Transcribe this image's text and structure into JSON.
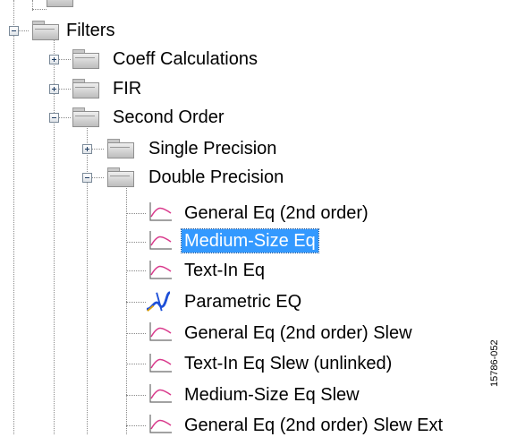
{
  "tree": {
    "filters": "Filters",
    "coeff_calculations": "Coeff Calculations",
    "fir": "FIR",
    "second_order": "Second Order",
    "single_precision": "Single Precision",
    "double_precision": "Double Precision",
    "items": [
      "General Eq (2nd order)",
      "Medium-Size Eq",
      "Text-In Eq",
      "Parametric EQ",
      "General Eq (2nd order) Slew",
      "Text-In Eq Slew (unlinked)",
      "Medium-Size Eq Slew",
      "General Eq (2nd order) Slew Ext"
    ],
    "selected_item": "Medium-Size Eq"
  },
  "figure_id": "15786-052",
  "colors": {
    "selection": "#3399ff",
    "connector": "#8a8a8a",
    "parametric_icon": "#1d4fd8"
  },
  "icons": {
    "folder": "folder-icon",
    "leaf": "graph-curve-icon",
    "parametric": "parametric-eq-icon",
    "expanded": "collapse-minus-icon",
    "collapsed": "expand-plus-icon"
  }
}
